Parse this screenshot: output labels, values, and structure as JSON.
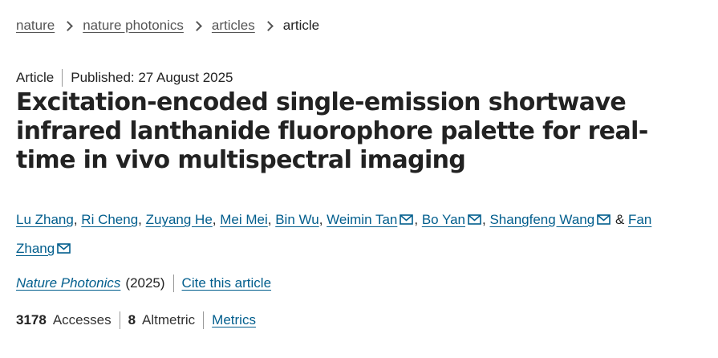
{
  "breadcrumb": {
    "items": [
      "nature",
      "nature photonics",
      "articles"
    ],
    "current": "article"
  },
  "meta": {
    "type": "Article",
    "published": "Published: 27 August 2025"
  },
  "title": "Excitation-encoded single-emission shortwave infrared lanthanide fluorophore palette for real-time in vivo multispectral imaging",
  "authors": [
    {
      "name": "Lu Zhang",
      "mail": false,
      "sep": ", "
    },
    {
      "name": "Ri Cheng",
      "mail": false,
      "sep": ", "
    },
    {
      "name": "Zuyang He",
      "mail": false,
      "sep": ", "
    },
    {
      "name": "Mei Mei",
      "mail": false,
      "sep": ", "
    },
    {
      "name": "Bin Wu",
      "mail": false,
      "sep": ", "
    },
    {
      "name": "Weimin Tan",
      "mail": true,
      "sep": ", "
    },
    {
      "name": "Bo Yan",
      "mail": true,
      "sep": ", "
    },
    {
      "name": "Shangfeng Wang",
      "mail": true,
      "sep": " & "
    },
    {
      "name": "Fan Zhang",
      "mail": true,
      "sep": ""
    }
  ],
  "citation": {
    "journal": "Nature Photonics",
    "year": "(2025)",
    "cite_label": "Cite this article"
  },
  "metrics": {
    "accesses_count": "3178",
    "accesses_label": "Accesses",
    "altmetric_count": "8",
    "altmetric_label": "Altmetric",
    "metrics_link": "Metrics"
  },
  "colors": {
    "link": "#025e8d",
    "text": "#222222",
    "breadcrumb_link": "#555555"
  },
  "icons": {
    "breadcrumb_separator": "chevron-right-icon",
    "author_contact": "mail-icon"
  }
}
